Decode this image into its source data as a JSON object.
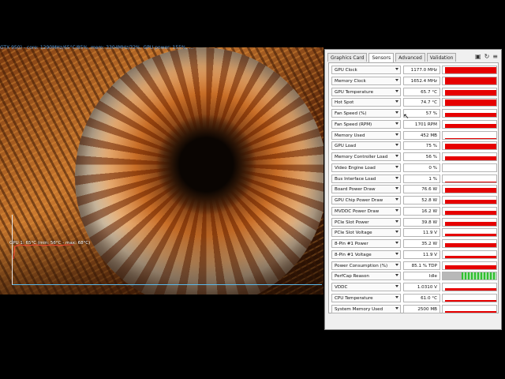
{
  "overlay": {
    "top_osd": "GTX 950) - core: 1290MHz/65°C/85%, mem: 3304MHz/32%, GPU power: 155%, ...",
    "temp_graph_label": "GPU 1: 65°C (min: 56°C - max: 68°C)"
  },
  "gpuz": {
    "tabs": [
      "Graphics Card",
      "Sensors",
      "Advanced",
      "Validation"
    ],
    "active_tab": "Sensors",
    "icons": [
      "camera-icon",
      "refresh-icon",
      "menu-icon"
    ],
    "sensors": [
      {
        "label": "GPU Clock",
        "value": "1177.0 MHz",
        "level": 0.92
      },
      {
        "label": "Memory Clock",
        "value": "1652.4 MHz",
        "level": 0.95
      },
      {
        "label": "GPU Temperature",
        "value": "65.7 °C",
        "level": 0.8
      },
      {
        "label": "Hot Spot",
        "value": "74.7 °C",
        "level": 0.85
      },
      {
        "label": "Fan Speed (%)",
        "value": "57 %",
        "level": 0.55
      },
      {
        "label": "Fan Speed (RPM)",
        "value": "1701 RPM",
        "level": 0.55
      },
      {
        "label": "Memory Used",
        "value": "452 MB",
        "level": 0.12
      },
      {
        "label": "GPU Load",
        "value": "75 %",
        "level": 0.75
      },
      {
        "label": "Memory Controller Load",
        "value": "56 %",
        "level": 0.58
      },
      {
        "label": "Video Engine Load",
        "value": "0 %",
        "level": 0.0
      },
      {
        "label": "Bus Interface Load",
        "value": "1 %",
        "level": 0.05
      },
      {
        "label": "Board Power Draw",
        "value": "76.6 W",
        "level": 0.65
      },
      {
        "label": "GPU Chip Power Draw",
        "value": "52.8 W",
        "level": 0.6
      },
      {
        "label": "MVDDC Power Draw",
        "value": "16.2 W",
        "level": 0.6
      },
      {
        "label": "PCIe Slot Power",
        "value": "39.8 W",
        "level": 0.55
      },
      {
        "label": "PCIe Slot Voltage",
        "value": "11.9 V",
        "level": 0.3
      },
      {
        "label": "8-Pin #1 Power",
        "value": "35.2 W",
        "level": 0.55
      },
      {
        "label": "8-Pin #1 Voltage",
        "value": "11.9 V",
        "level": 0.3
      },
      {
        "label": "Power Consumption (%)",
        "value": "85.1 % TDP",
        "level": 0.6
      },
      {
        "label": "PerfCap Reason",
        "value": "Idle",
        "level": 0.0,
        "perfcap": true
      },
      {
        "label": "VDDC",
        "value": "1.0310 V",
        "level": 0.35
      },
      {
        "label": "CPU Temperature",
        "value": "61.0 °C",
        "level": 0.25
      },
      {
        "label": "System Memory Used",
        "value": "2500 MB",
        "level": 0.2
      }
    ]
  }
}
